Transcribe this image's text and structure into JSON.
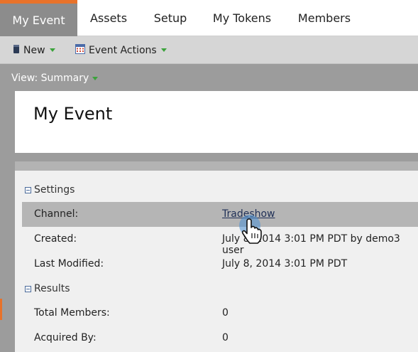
{
  "tabs": [
    {
      "label": "My Event",
      "active": true
    },
    {
      "label": "Assets",
      "active": false
    },
    {
      "label": "Setup",
      "active": false
    },
    {
      "label": "My Tokens",
      "active": false
    },
    {
      "label": "Members",
      "active": false
    }
  ],
  "toolbar": {
    "new_label": "New",
    "event_actions_label": "Event Actions"
  },
  "view": {
    "label": "View: Summary"
  },
  "page": {
    "title": "My Event"
  },
  "settings": {
    "heading": "Settings",
    "rows": [
      {
        "label": "Channel:",
        "value": "Tradeshow"
      },
      {
        "label": "Created:",
        "value": "July 8, 2014 3:01 PM PDT by demo3 user"
      },
      {
        "label": "Last Modified:",
        "value": "July 8, 2014 3:01 PM PDT"
      }
    ]
  },
  "results": {
    "heading": "Results",
    "rows": [
      {
        "label": "Total Members:",
        "value": "0"
      },
      {
        "label": "Acquired By:",
        "value": "0"
      }
    ]
  },
  "colors": {
    "accent": "#e8722a",
    "active_tab": "#8c8c8c",
    "toolbar": "#d6d6d6",
    "content_bg": "#9c9c9c",
    "caret": "#3ba33b",
    "highlight_row": "#b5b5b5"
  },
  "icons": {
    "new": "document-icon",
    "event_actions": "calendar-icon",
    "cursor": "hand-pointer-icon"
  }
}
